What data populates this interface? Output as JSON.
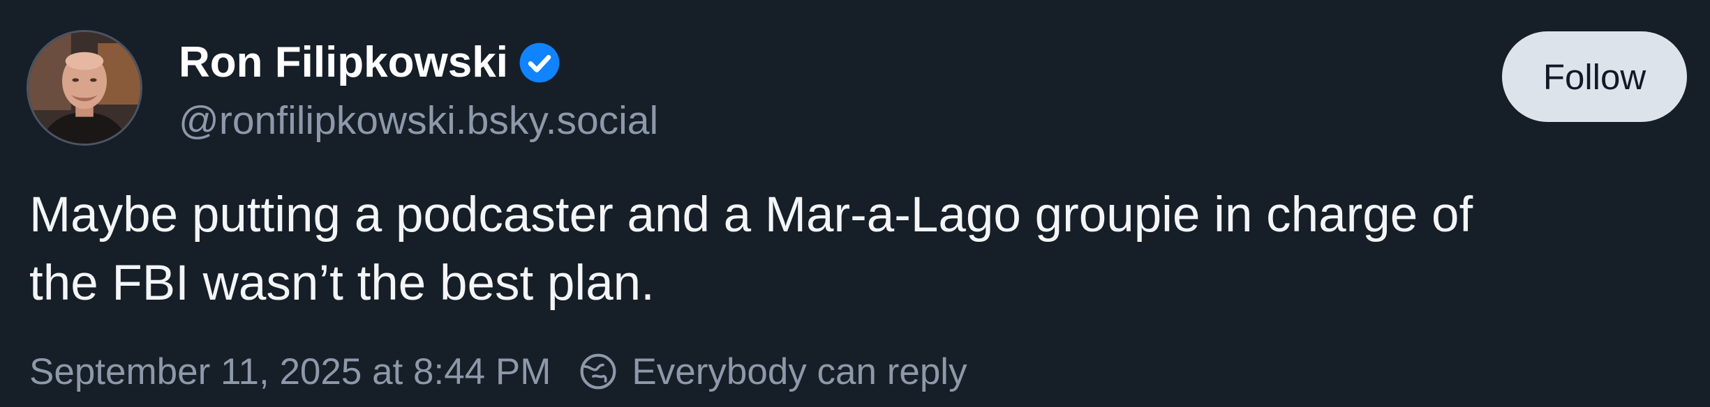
{
  "author": {
    "name": "Ron Filipkowski",
    "handle": "@ronfilipkowski.bsky.social",
    "verified": true
  },
  "follow_button": {
    "label": "Follow"
  },
  "post": {
    "text_lines": [
      "Maybe putting a podcaster and a Mar-a-Lago groupie in charge of",
      "the FBI wasn’t the best plan."
    ]
  },
  "meta": {
    "timestamp": "September 11, 2025 at 8:44 PM",
    "reply_setting": "Everybody can reply"
  },
  "colors": {
    "background": "#161e27",
    "verified_badge": "#1083fe",
    "muted_text": "#8d99aa",
    "follow_button_bg": "#dde3ea"
  },
  "icons": {
    "verified": "verified-check-icon",
    "reply": "globe-reply-icon"
  }
}
